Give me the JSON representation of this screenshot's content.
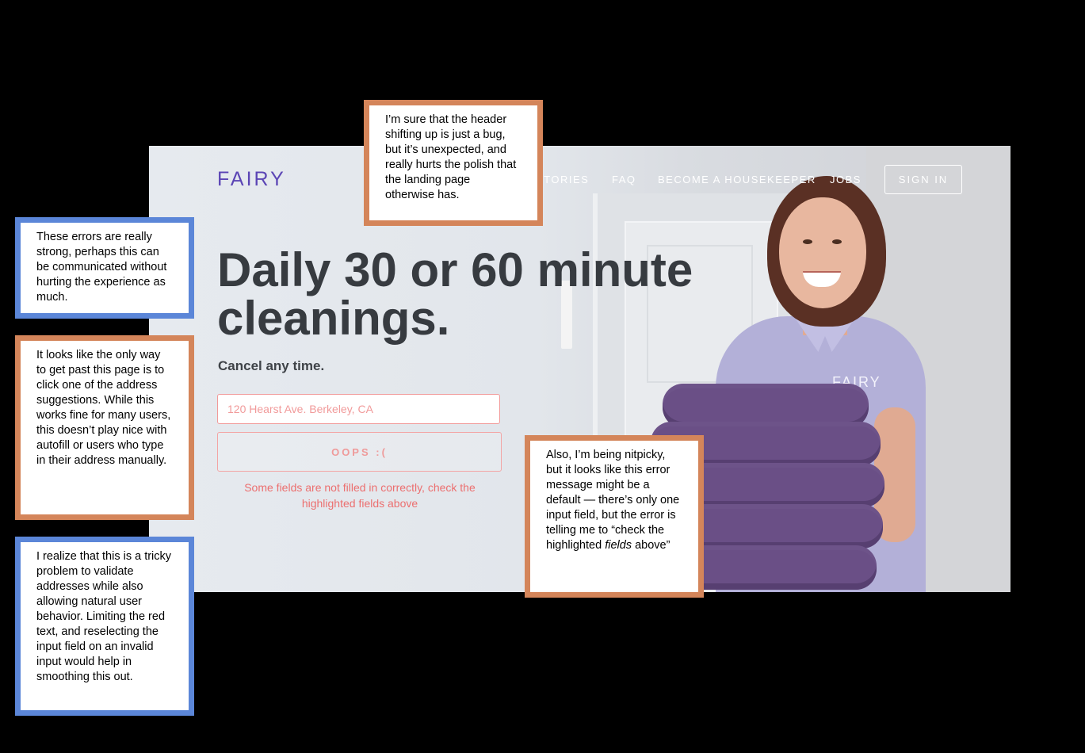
{
  "landing": {
    "logo": "FAIRY",
    "nav": [
      "STORIES",
      "FAQ",
      "BECOME A HOUSEKEEPER",
      "JOBS"
    ],
    "sign_in": "SIGN IN",
    "headline": "Daily 30 or 60 minute cleanings.",
    "subheadline": "Cancel any time.",
    "address_placeholder": "120 Hearst Ave. Berkeley, CA",
    "submit_label": "OOPS :(",
    "error_message": "Some fields are not filled in correctly, check the highlighted fields above",
    "shirt_logo": "FAIRY"
  },
  "annotations": {
    "header_bug": "I’m sure that the header shifting up is just a bug, but it’s unexpected, and really hurts the polish that the landing page otherwise has.",
    "errors_strong": "These errors are really strong, perhaps this can be communicated without hurting the experience as much.",
    "address_suggestions": "It looks like the only way to get past this page is to click one of the address suggestions. While this works fine for many users, this doesn’t play nice with autofill or users who type in their address manually.",
    "tricky_problem": "I realize that this is a tricky problem to validate addresses while also allowing natural user behavior. Limiting the red text, and reselecting the input field on an invalid input would help in smoothing this out.",
    "nitpicky_before": "Also, I’m being nitpicky, but it looks like this error message might be a default — there’s only one input field, but the error is telling me to “check the highlighted",
    "nitpicky_italic": "fields",
    "nitpicky_after": " above”"
  },
  "colors": {
    "blue_border": "#5b86d8",
    "orange_border": "#d4855a",
    "brand_purple": "#5b45b5",
    "error_red": "#ec6f6f"
  }
}
